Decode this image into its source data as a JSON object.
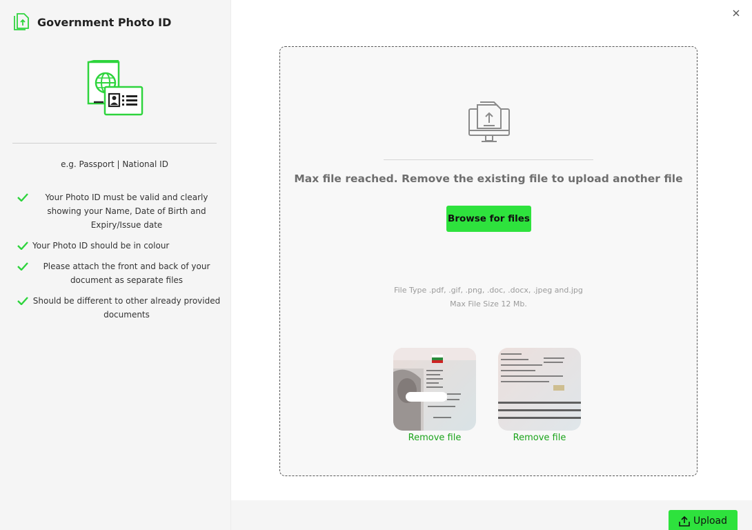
{
  "sidebar": {
    "title": "Government Photo ID",
    "example_text": "e.g. Passport | National ID",
    "rules": [
      "Your Photo ID must be valid and clearly showing your Name, Date of Birth and Expiry/Issue date",
      "Your Photo ID should be in colour",
      "Please attach the front and back of your document as separate files",
      "Should be different to other already provided documents"
    ]
  },
  "dropzone": {
    "message": "Max file reached. Remove the existing file to upload another file",
    "browse_label": "Browse for files",
    "file_types": "File Type .pdf, .gif, .png, .doc, .docx, .jpeg and.jpg",
    "max_size": "Max File Size 12 Mb."
  },
  "files": [
    {
      "remove_label": "Remove file"
    },
    {
      "remove_label": "Remove file"
    }
  ],
  "footer": {
    "upload_label": "Upload"
  },
  "colors": {
    "accent": "#2ee23d",
    "link": "#1aa31a",
    "icon_green": "#2ed43d"
  }
}
